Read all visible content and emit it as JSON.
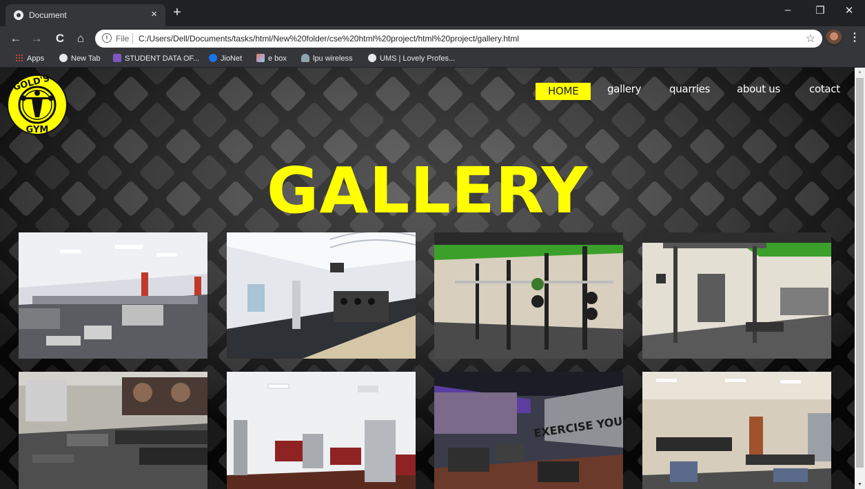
{
  "browser": {
    "tab_title": "Document",
    "tab_close": "×",
    "new_tab": "+",
    "window_controls": [
      "–",
      "❐",
      "✕"
    ],
    "nav_buttons": [
      "←",
      "→",
      "C",
      "⌂"
    ],
    "address": {
      "scheme_label": "File",
      "url": "C:/Users/Dell/Documents/tasks/html/New%20folder/cse%20html%20project/html%20project/gallery.html"
    },
    "bookmarks": [
      {
        "label": "Apps",
        "icon": "apps-grid-icon",
        "color": "#f4b400"
      },
      {
        "label": "New Tab",
        "icon": "globe-icon",
        "color": "#e8eaed"
      },
      {
        "label": "STUDENT DATA OF...",
        "icon": "form-icon",
        "color": "#7e57c2"
      },
      {
        "label": "JioNet",
        "icon": "jio-icon",
        "color": "#1a73e8"
      },
      {
        "label": "e box",
        "icon": "ebox-icon",
        "color": "#e57373"
      },
      {
        "label": "lpu wireless",
        "icon": "cloud-icon",
        "color": "#90a4ae"
      },
      {
        "label": "UMS | Lovely Profes...",
        "icon": "globe-icon",
        "color": "#e8eaed"
      }
    ]
  },
  "page": {
    "nav": {
      "home": "HOME",
      "gallery": "gallery",
      "quarries": "quarries",
      "about": "about us",
      "contact": "cotact"
    },
    "heading": "GALLERY",
    "logo_text": "GOLD'S GYM",
    "colors": {
      "accent": "#ffff00",
      "background": "#0c0c0c"
    },
    "photos": [
      "gym-floor-red-pillars",
      "gym-white-skylight",
      "squat-racks-green-wall",
      "cable-machine-green-wall",
      "gym-posters-dumbbells",
      "gym-red-machines",
      "gym-purple-exercise-your",
      "gym-beige-dumbbells"
    ]
  }
}
